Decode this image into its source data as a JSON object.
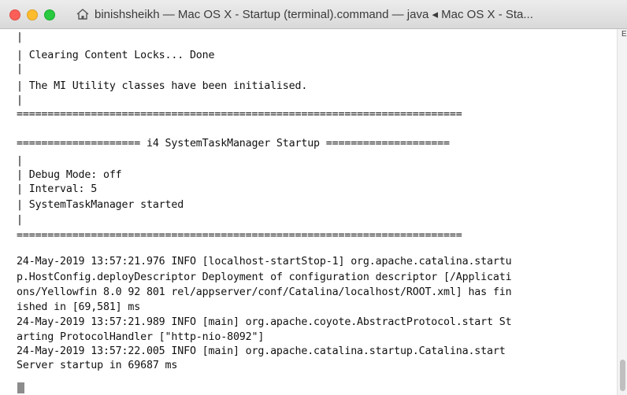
{
  "window": {
    "title": "binishsheikh — Mac OS X - Startup (terminal).command — java ◂ Mac OS X - Sta..."
  },
  "terminal": {
    "lines": [
      "|",
      "| Clearing Content Locks... Done",
      "|",
      "| The MI Utility classes have been initialised.",
      "|",
      "========================================================================",
      "",
      "==================== i4 SystemTaskManager Startup ====================",
      "|",
      "| Debug Mode: off",
      "| Interval: 5",
      "| SystemTaskManager started",
      "|",
      "========================================================================",
      "",
      "24-May-2019 13:57:21.976 INFO [localhost-startStop-1] org.apache.catalina.startu",
      "p.HostConfig.deployDescriptor Deployment of configuration descriptor [/Applicati",
      "ons/Yellowfin 8.0 92 801 rel/appserver/conf/Catalina/localhost/ROOT.xml] has fin",
      "ished in [69,581] ms",
      "24-May-2019 13:57:21.989 INFO [main] org.apache.coyote.AbstractProtocol.start St",
      "arting ProtocolHandler [\"http-nio-8092\"]",
      "24-May-2019 13:57:22.005 INFO [main] org.apache.catalina.startup.Catalina.start",
      "Server startup in 69687 ms"
    ],
    "corner_label": "E"
  },
  "colors": {
    "close": "#fc5f57",
    "minimize": "#fdbc2e",
    "zoom": "#29c940"
  },
  "icons": {
    "title_icon": "home-icon"
  }
}
